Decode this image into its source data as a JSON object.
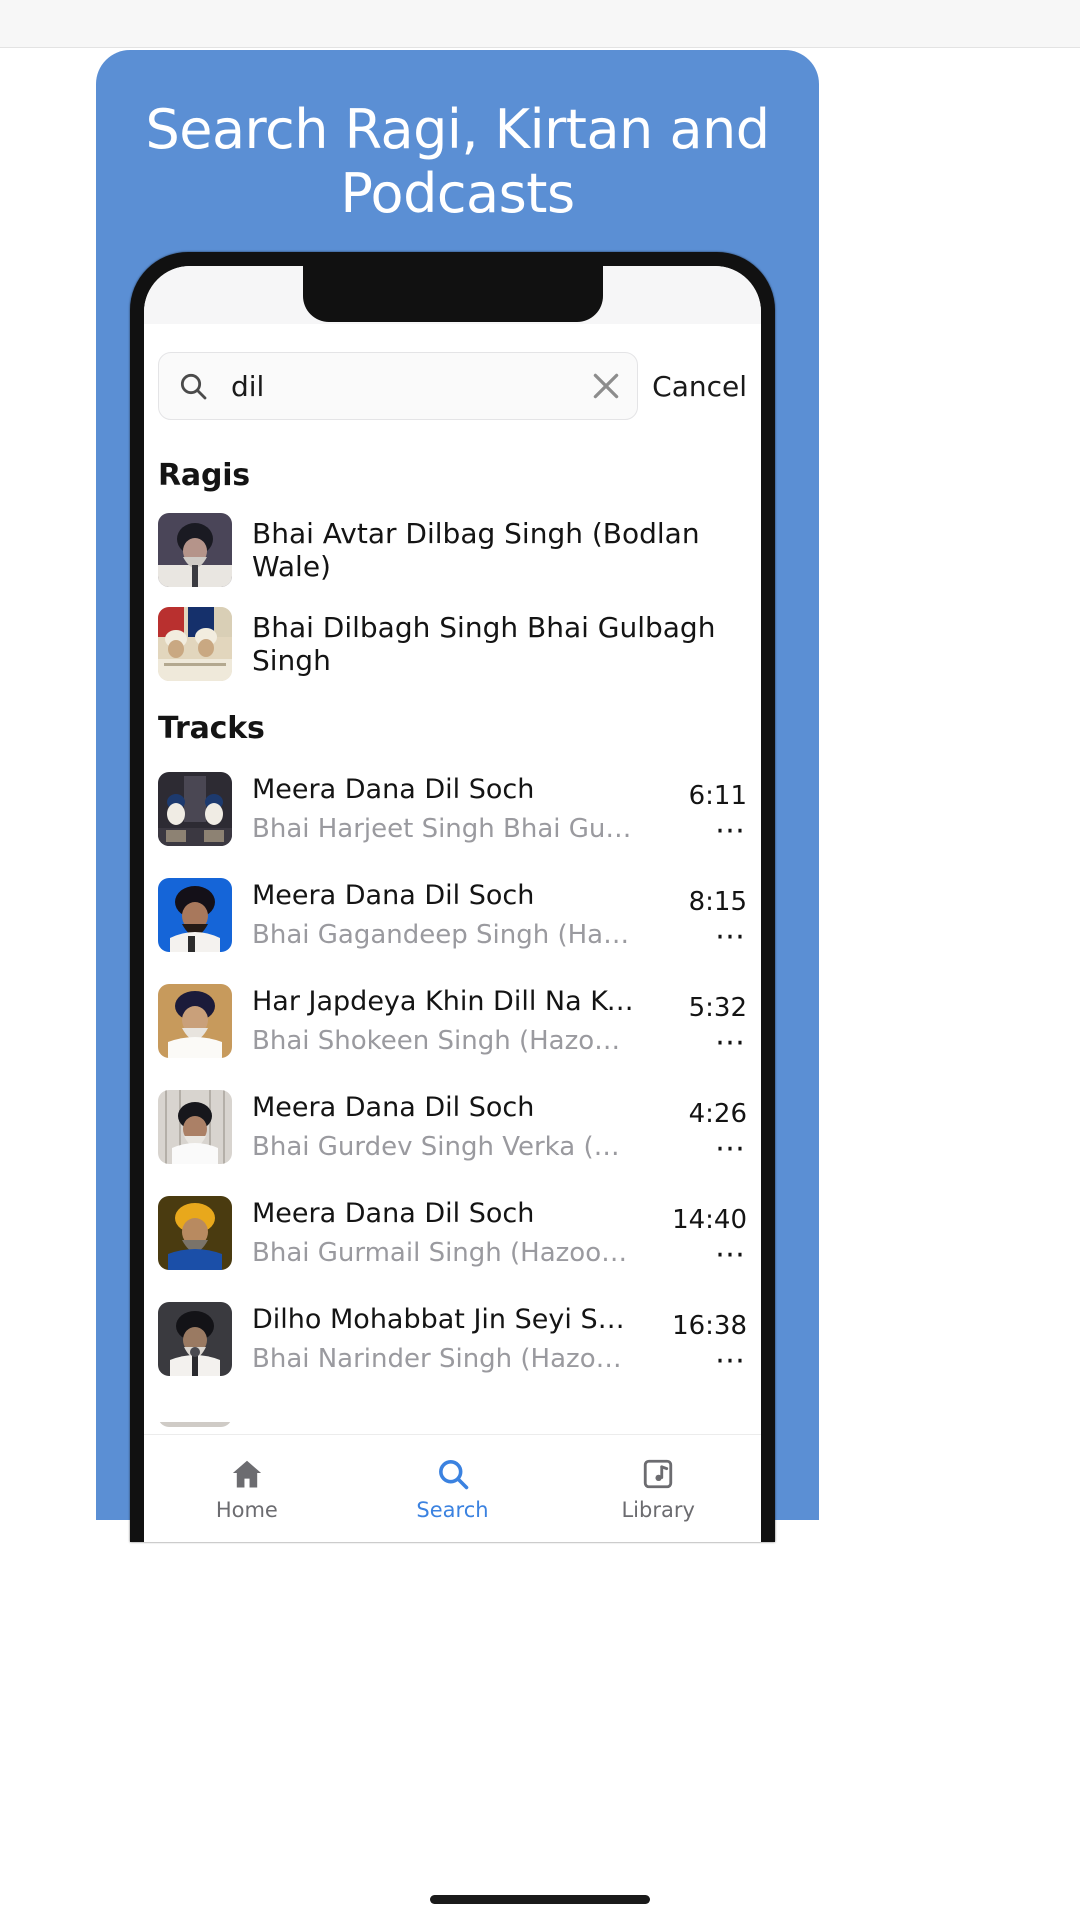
{
  "promo": {
    "headline": "Search Ragi, Kirtan and Podcasts",
    "background_color": "#5b8fd4",
    "text_color": "#ffffff"
  },
  "search": {
    "icon": "search-icon",
    "value": "dil",
    "placeholder": "Search",
    "clear_icon": "close-icon",
    "cancel_label": "Cancel"
  },
  "sections": {
    "ragis_title": "Ragis",
    "tracks_title": "Tracks"
  },
  "ragis": [
    {
      "name": "Bhai Avtar Dilbag Singh (Bodlan Wale)",
      "thumb_colors": [
        "#4a4558",
        "#ded9d4"
      ]
    },
    {
      "name": "Bhai Dilbagh Singh Bhai Gulbagh Singh",
      "thumb_colors": [
        "#b9302f",
        "#e2d6bd"
      ]
    }
  ],
  "tracks": [
    {
      "title": "Meera Dana Dil Soch",
      "artist": "Bhai Harjeet Singh Bhai Gurdeep Singh",
      "duration": "6:11",
      "menu_icon": "more-horizontal-icon",
      "thumb_colors": [
        "#2d2b33",
        "#c9c7c2"
      ]
    },
    {
      "title": "Meera Dana Dil Soch",
      "artist": "Bhai Gagandeep Singh (Hazoori Ragi)",
      "duration": "8:15",
      "menu_icon": "more-horizontal-icon",
      "thumb_colors": [
        "#1565d8",
        "#0f4fa8"
      ]
    },
    {
      "title": "Har Japdeya Khin Dill Na Keejeye",
      "artist": "Bhai Shokeen Singh (Hazoori Ragi)",
      "duration": "5:32",
      "menu_icon": "more-horizontal-icon",
      "thumb_colors": [
        "#c79a5c",
        "#b7884a"
      ]
    },
    {
      "title": "Meera Dana Dil Soch",
      "artist": "Bhai Gurdev Singh Verka (Hazoori Ragi)",
      "duration": "4:26",
      "menu_icon": "more-horizontal-icon",
      "thumb_colors": [
        "#d8d4cf",
        "#a9a39c"
      ]
    },
    {
      "title": "Meera Dana Dil Soch",
      "artist": "Bhai Gurmail Singh (Hazoori Ragi)",
      "duration": "14:40",
      "menu_icon": "more-horizontal-icon",
      "thumb_colors": [
        "#4a3b10",
        "#e8a81c"
      ]
    },
    {
      "title": "Dilho Mohabbat Jin Seyi Sacheya",
      "artist": "Bhai Narinder Singh (Hazoori Ragi)",
      "duration": "16:38",
      "menu_icon": "more-horizontal-icon",
      "thumb_colors": [
        "#3a3a3f",
        "#d2cfca"
      ]
    }
  ],
  "tabbar": {
    "accent_color": "#3b82e0",
    "inactive_color": "#6c6c70",
    "items": [
      {
        "label": "Home",
        "icon": "home-icon",
        "active": false
      },
      {
        "label": "Search",
        "icon": "search-icon",
        "active": true
      },
      {
        "label": "Library",
        "icon": "library-music-icon",
        "active": false
      }
    ]
  }
}
